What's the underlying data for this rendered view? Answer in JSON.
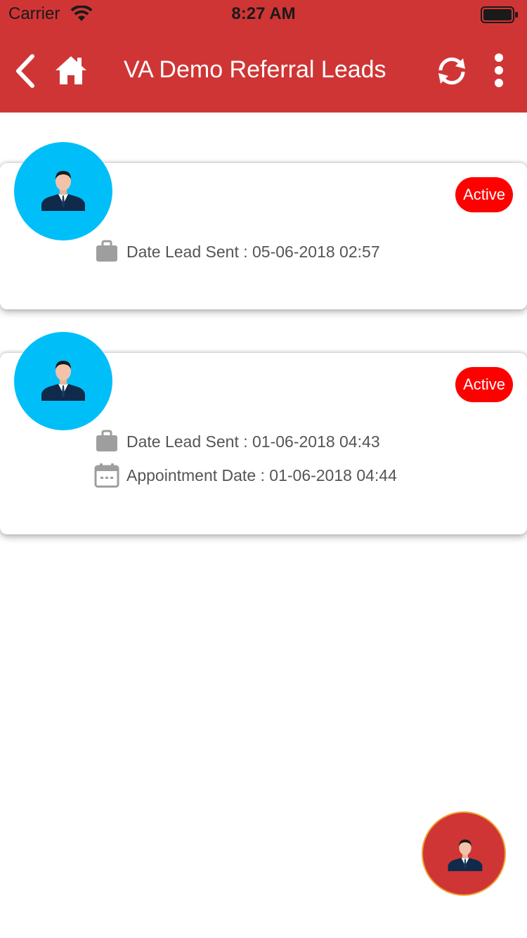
{
  "status_bar": {
    "carrier": "Carrier",
    "time": "8:27 AM",
    "wifi_icon": "wifi-icon",
    "battery_icon": "battery-icon"
  },
  "header": {
    "title": "VA Demo Referral Leads",
    "background_color": "#d03535",
    "back_icon": "chevron-left-icon",
    "home_icon": "home-icon",
    "refresh_icon": "refresh-icon",
    "more_icon": "more-vertical-icon"
  },
  "leads": [
    {
      "avatar_icon": "user-avatar-icon",
      "status": "Active",
      "details": [
        {
          "icon": "briefcase-icon",
          "label": "Date Lead Sent",
          "value": "05-06-2018 02:57",
          "text": "Date Lead Sent : 05-06-2018 02:57"
        }
      ]
    },
    {
      "avatar_icon": "user-avatar-icon",
      "status": "Active",
      "details": [
        {
          "icon": "briefcase-icon",
          "label": "Date Lead Sent",
          "value": "01-06-2018 04:43",
          "text": "Date Lead Sent : 01-06-2018 04:43"
        },
        {
          "icon": "calendar-icon",
          "label": "Appointment Date",
          "value": "01-06-2018 04:44",
          "text": "Appointment Date : 01-06-2018 04:44"
        }
      ]
    }
  ],
  "colors": {
    "accent": "#d03535",
    "avatar_bg": "#00bff8",
    "badge": "#ff0000",
    "detail_text": "#555555"
  },
  "fab": {
    "icon": "add-lead-user-icon"
  }
}
